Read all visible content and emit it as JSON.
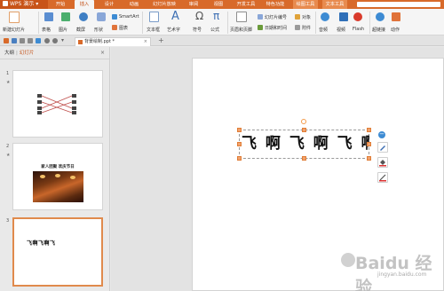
{
  "app": {
    "name": "WPS 演示"
  },
  "menu_tabs": [
    {
      "label": "开始",
      "active": false
    },
    {
      "label": "插入",
      "active": true
    },
    {
      "label": "设计",
      "active": false
    },
    {
      "label": "动画",
      "active": false
    },
    {
      "label": "幻灯片放映",
      "active": false
    },
    {
      "label": "审阅",
      "active": false
    },
    {
      "label": "视图",
      "active": false
    },
    {
      "label": "开发工具",
      "active": false
    },
    {
      "label": "特色功能",
      "active": false
    },
    {
      "label": "绘图工具",
      "active": false
    },
    {
      "label": "文本工具",
      "active": false
    }
  ],
  "ribbon": {
    "new_slide": "新建幻灯片",
    "table": "表格",
    "picture": "图片",
    "screenshot": "截屏",
    "shape": "形状",
    "smartart": "SmartArt",
    "chart": "图表",
    "textbox": "文本框",
    "wordart": "艺术字",
    "symbol": "符号",
    "formula": "公式",
    "header_footer": "页眉和页脚",
    "slide_number": "幻灯片编号",
    "object": "对象",
    "datetime": "日期和时间",
    "attachment": "附件",
    "audio": "音频",
    "video": "视频",
    "flash": "Flash",
    "hyperlink": "超链接",
    "action": "动作"
  },
  "document_tab": {
    "title": "背景绘制.ppt *",
    "close": "×"
  },
  "add_tab": "+",
  "panel": {
    "outline": "大纲",
    "separator": "|",
    "slides": "幻灯片",
    "close": "×"
  },
  "slides": [
    {
      "number": "1",
      "star": "★",
      "selected": false
    },
    {
      "number": "2",
      "star": "★",
      "title": "家人团聚 欢庆节日",
      "selected": false
    },
    {
      "number": "3",
      "text": "飞啊飞啊飞",
      "selected": true
    }
  ],
  "slide_text": "飞 啊 飞 啊 飞 啊 飞",
  "watermark": {
    "brand": "Baidu 经验",
    "sub": "jingyan.baidu.com"
  },
  "colors": {
    "brand": "#d86a2a",
    "active_tab_text": "#c4531a",
    "selection": "#e08a4c"
  }
}
